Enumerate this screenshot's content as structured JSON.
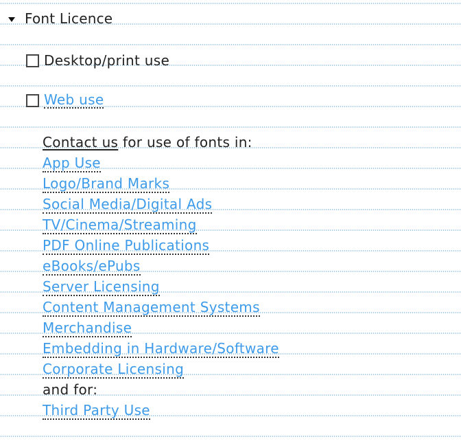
{
  "section": {
    "title": "Font Licence",
    "expanded": true
  },
  "options": [
    {
      "label": "Desktop/print use",
      "checked": false,
      "style": "plain"
    },
    {
      "label": "Web use",
      "checked": false,
      "style": "link"
    }
  ],
  "contact": {
    "link_label": "Contact us",
    "suffix": " for use of fonts in:",
    "uses": [
      "App Use",
      "Logo/Brand Marks",
      "Social Media/Digital Ads",
      "TV/Cinema/Streaming",
      "PDF Online Publications",
      "eBooks/ePubs",
      "Server Licensing",
      "Content Management Systems",
      "Merchandise",
      "Embedding in Hardware/Software",
      "Corporate Licensing"
    ],
    "and_for": "and for:",
    "third_party": "Third Party Use"
  },
  "colors": {
    "link": "#3d9be9",
    "text": "#222222",
    "rule": "#8fbfe0"
  }
}
